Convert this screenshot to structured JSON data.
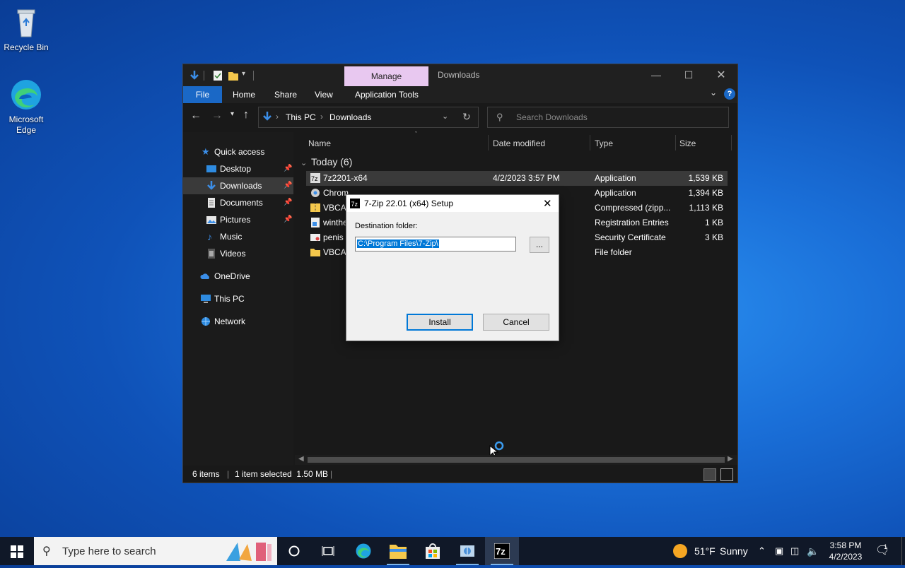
{
  "desktop": {
    "icons": [
      {
        "label": "Recycle Bin",
        "icon": "recycle-bin-icon"
      },
      {
        "label": "Microsoft Edge",
        "icon": "edge-icon"
      }
    ]
  },
  "explorer": {
    "quick_access_toolbar": [
      "download-arrow-icon",
      "properties-icon",
      "new-folder-icon",
      "customize-qat-icon"
    ],
    "context_tab": "Manage",
    "title": "Downloads",
    "ribbon_tabs": [
      "File",
      "Home",
      "Share",
      "View",
      "Application Tools"
    ],
    "address": {
      "root": "This PC",
      "current": "Downloads"
    },
    "search_placeholder": "Search Downloads",
    "nav_pane": [
      {
        "label": "Quick access",
        "icon": "star-icon",
        "pinned": false,
        "selected": false
      },
      {
        "label": "Desktop",
        "icon": "desktop-icon",
        "pinned": true,
        "selected": false
      },
      {
        "label": "Downloads",
        "icon": "download-icon",
        "pinned": true,
        "selected": true
      },
      {
        "label": "Documents",
        "icon": "documents-icon",
        "pinned": true,
        "selected": false
      },
      {
        "label": "Pictures",
        "icon": "pictures-icon",
        "pinned": true,
        "selected": false
      },
      {
        "label": "Music",
        "icon": "music-icon",
        "pinned": false,
        "selected": false
      },
      {
        "label": "Videos",
        "icon": "videos-icon",
        "pinned": false,
        "selected": false
      },
      {
        "label": "OneDrive",
        "icon": "cloud-icon",
        "pinned": false,
        "selected": false
      },
      {
        "label": "This PC",
        "icon": "computer-icon",
        "pinned": false,
        "selected": false
      },
      {
        "label": "Network",
        "icon": "network-icon",
        "pinned": false,
        "selected": false
      }
    ],
    "columns": [
      "Name",
      "Date modified",
      "Type",
      "Size"
    ],
    "group_header": "Today (6)",
    "files": [
      {
        "name": "7z2201-x64",
        "date": "4/2/2023 3:57 PM",
        "type": "Application",
        "size": "1,539 KB",
        "icon": "7zip-icon",
        "selected": true
      },
      {
        "name": "Chrom",
        "date": "",
        "type": "Application",
        "size": "1,394 KB",
        "icon": "chrome-setup-icon",
        "selected": false
      },
      {
        "name": "VBCAB",
        "date": "",
        "type": "Compressed (zipp...",
        "size": "1,113 KB",
        "icon": "zip-folder-icon",
        "selected": false
      },
      {
        "name": "winthe",
        "date": "",
        "type": "Registration Entries",
        "size": "1 KB",
        "icon": "registry-icon",
        "selected": false
      },
      {
        "name": "penis",
        "date": "",
        "type": "Security Certificate",
        "size": "3 KB",
        "icon": "certificate-icon",
        "selected": false
      },
      {
        "name": "VBCAB",
        "date": "",
        "type": "File folder",
        "size": "",
        "icon": "folder-icon",
        "selected": false
      }
    ],
    "status": {
      "items": "6 items",
      "selected": "1 item selected  1.50 MB"
    }
  },
  "dialog": {
    "title": "7-Zip 22.01 (x64) Setup",
    "destination_label": "Destination folder:",
    "destination_value": "C:\\Program Files\\7-Zip\\",
    "browse_label": "...",
    "install_label": "Install",
    "cancel_label": "Cancel"
  },
  "taskbar": {
    "search_placeholder": "Type here to search",
    "apps": [
      "cortana-icon",
      "task-view-icon",
      "edge-icon",
      "file-explorer-icon",
      "store-icon",
      "control-panel-icon",
      "7zip-icon"
    ],
    "weather": {
      "temp": "51°F",
      "condition": "Sunny"
    },
    "clock": {
      "time": "3:58 PM",
      "date": "4/2/2023"
    },
    "notification_count": "1"
  },
  "colors": {
    "accent": "#0078d7",
    "manage_tab": "#e8c8f0",
    "file_tab": "#1a68c6"
  }
}
